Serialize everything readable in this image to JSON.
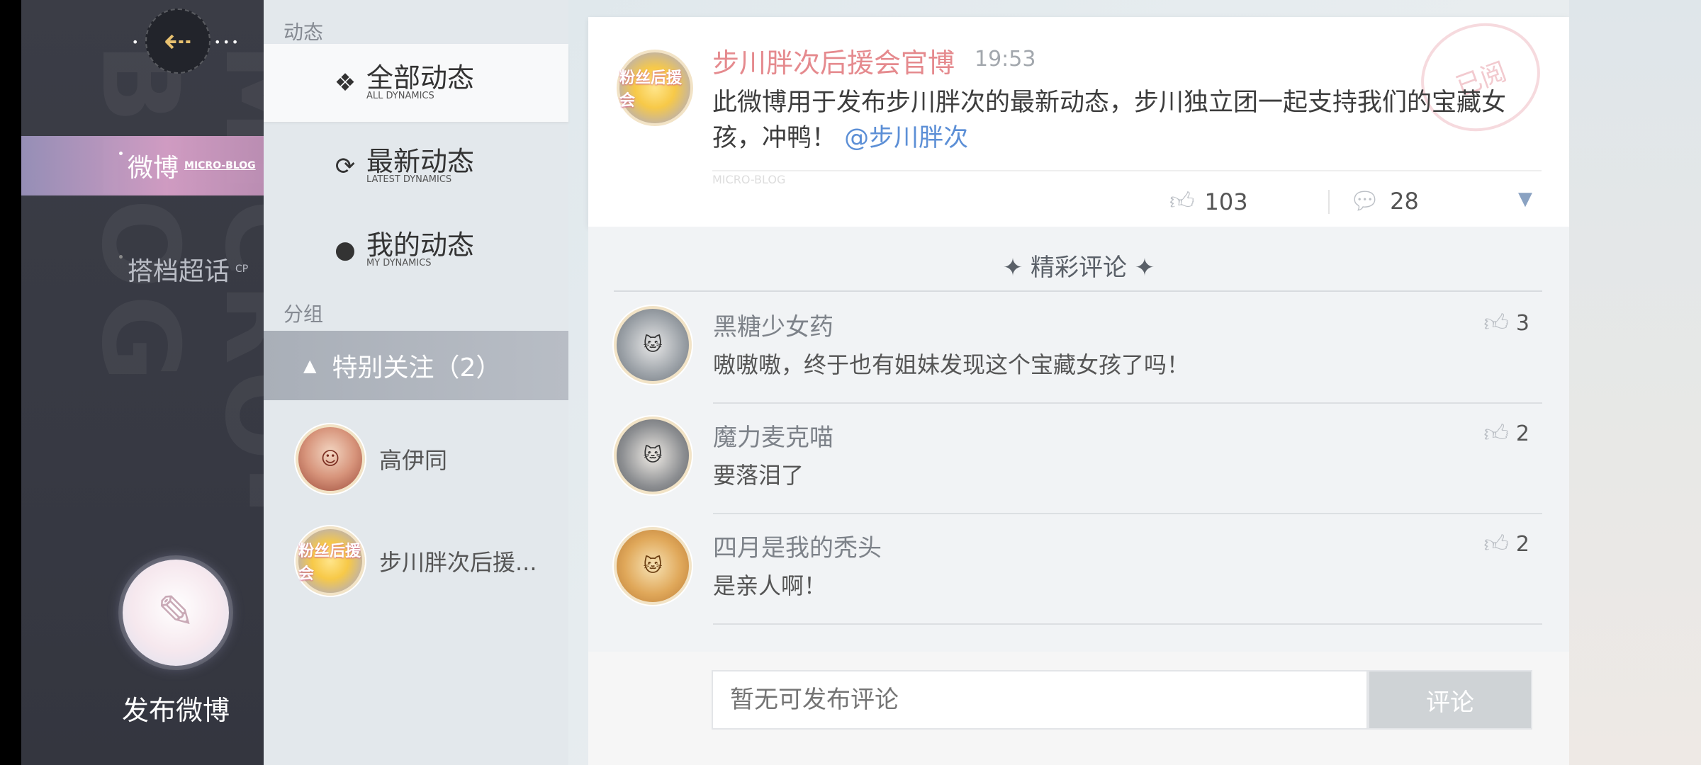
{
  "sidebar": {
    "watermark": "MICRO-BLOG",
    "items": [
      {
        "label": "微博",
        "sub": "MICRO-BLOG"
      },
      {
        "label": "搭档超话",
        "sub": "CP"
      }
    ],
    "compose_label": "发布微博"
  },
  "middle": {
    "section_dynamics": "动态",
    "filters": [
      {
        "label": "全部动态",
        "sub": "ALL DYNAMICS",
        "icon": "sparkle-icon"
      },
      {
        "label": "最新动态",
        "sub": "LATEST DYNAMICS",
        "icon": "refresh-icon"
      },
      {
        "label": "我的动态",
        "sub": "MY DYNAMICS",
        "icon": "person-icon"
      }
    ],
    "section_group": "分组",
    "group_label": "特别关注（2）",
    "contacts": [
      {
        "name": "高伊同"
      },
      {
        "name": "步川胖次后援..."
      }
    ]
  },
  "post": {
    "author": "步川胖次后援会官博",
    "time": "19:53",
    "content": "此微博用于发布步川胖次的最新动态，步川独立团一起支持我们的宝藏女孩，冲鸭！",
    "mention": "@步川胖次",
    "stamp": "已阅",
    "tag": "MICRO-BLOG",
    "likes": "103",
    "comments": "28",
    "avatar_text": "粉丝后援会"
  },
  "comments_section": {
    "title": "✦ 精彩评论 ✦",
    "items": [
      {
        "name": "黑糖少女药",
        "text": "嗷嗷嗷，终于也有姐妹发现这个宝藏女孩了吗！",
        "likes": "3"
      },
      {
        "name": "魔力麦克喵",
        "text": "要落泪了",
        "likes": "2"
      },
      {
        "name": "四月是我的秃头",
        "text": "是亲人啊！",
        "likes": "2"
      }
    ]
  },
  "input": {
    "placeholder": "暂无可发布评论",
    "submit_label": "评论"
  },
  "colors": {
    "author_pink": "#e58a8e",
    "mention_blue": "#5c8fd6",
    "accent_gold": "#e8c170"
  }
}
